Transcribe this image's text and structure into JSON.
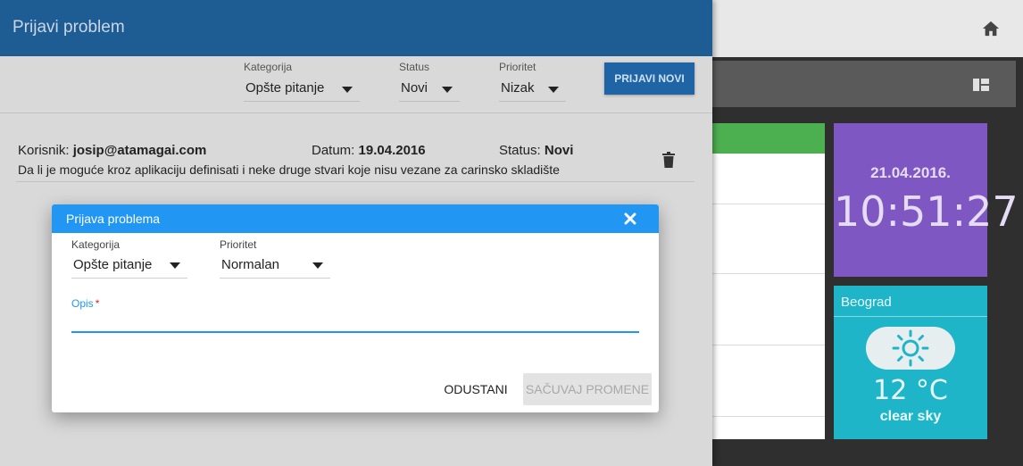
{
  "drawer": {
    "title": "Prijavi problem",
    "filters": [
      {
        "label": "Kategorija",
        "value": "Opšte pitanje"
      },
      {
        "label": "Status",
        "value": "Novi"
      },
      {
        "label": "Prioritet",
        "value": "Nizak"
      }
    ],
    "new_button": "PRIJAVI NOVI",
    "ticket": {
      "user_label": "Korisnik:",
      "user_value": "josip@atamagai.com",
      "date_label": "Datum:",
      "date_value": "19.04.2016",
      "status_label": "Status:",
      "status_value": "Novi",
      "description": "Da li je moguće kroz aplikaciju definisati i neke druge stvari koje nisu vezane za carinsko skladište"
    }
  },
  "modal": {
    "title": "Prijava problema",
    "category": {
      "label": "Kategorija",
      "value": "Opšte pitanje"
    },
    "priority": {
      "label": "Prioritet",
      "value": "Normalan"
    },
    "description": {
      "label": "Opis",
      "required_mark": "*",
      "value": ""
    },
    "cancel_label": "ODUSTANI",
    "save_label": "SAČUVAJ PROMENE"
  },
  "dashboard": {
    "clock": {
      "date": "21.04.2016.",
      "time": "10:51:27"
    },
    "weather": {
      "city": "Beograd",
      "temperature": "12 °C",
      "description": "clear sky"
    }
  },
  "colors": {
    "drawer_header": "#1e5c94",
    "modal_header": "#2196f3",
    "clock_tile": "#7e57c2",
    "weather_tile": "#1fb5c9",
    "panel_accent": "#4caf50"
  },
  "icons": [
    "home-icon",
    "grid-icon",
    "trash-icon",
    "close-icon",
    "sun-icon",
    "caret-down-icon"
  ]
}
